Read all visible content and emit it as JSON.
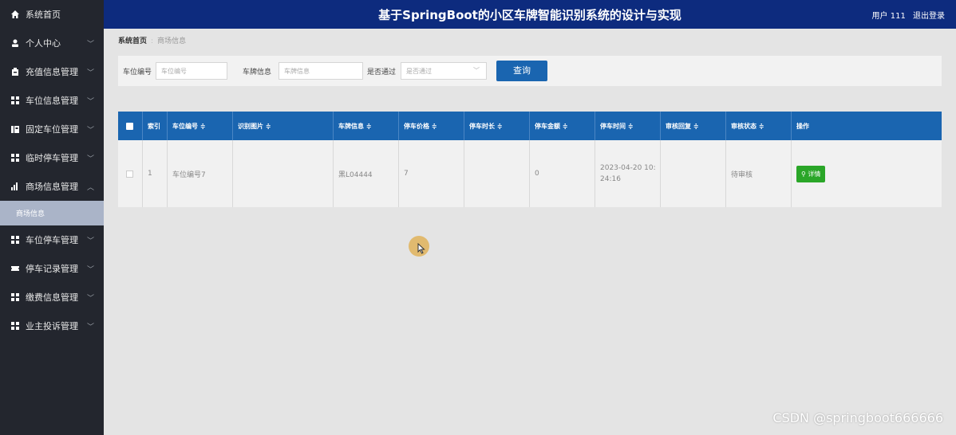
{
  "app": {
    "title": "基于SpringBoot的小区车牌智能识别系统的设计与实现",
    "user_label": "用户 111",
    "logout_label": "退出登录"
  },
  "sidebar": {
    "home": "系统首页",
    "items": [
      {
        "label": "个人中心",
        "icon": "user-icon"
      },
      {
        "label": "充值信息管理",
        "icon": "wallet-icon"
      },
      {
        "label": "车位信息管理",
        "icon": "grid-icon"
      },
      {
        "label": "固定车位管理",
        "icon": "parking-icon"
      },
      {
        "label": "临时停车管理",
        "icon": "grid-icon"
      },
      {
        "label": "商场信息管理",
        "icon": "bar-chart-icon"
      },
      {
        "label": "车位停车管理",
        "icon": "grid-icon"
      },
      {
        "label": "停车记录管理",
        "icon": "ticket-icon"
      },
      {
        "label": "缴费信息管理",
        "icon": "grid-icon"
      },
      {
        "label": "业主投诉管理",
        "icon": "grid-icon"
      }
    ],
    "active_sub": "商场信息"
  },
  "breadcrumb": {
    "root": "系统首页",
    "current": "商场信息"
  },
  "search": {
    "space_label": "车位编号",
    "space_placeholder": "车位编号",
    "plate_label": "车牌信息",
    "plate_placeholder": "车牌信息",
    "pass_label": "是否通过",
    "pass_placeholder": "是否通过",
    "query_button": "查询"
  },
  "table": {
    "headers": [
      "索引",
      "车位编号 ≑",
      "识别图片 ≑",
      "车牌信息 ≑",
      "停车价格 ≑",
      "停车时长 ≑",
      "停车金额 ≑",
      "停车时间 ≑",
      "审核回复 ≑",
      "审核状态 ≑",
      "操作"
    ],
    "rows": [
      {
        "index": "1",
        "space": "车位编号7",
        "image": "",
        "plate": "黑L04444",
        "price": "7",
        "duration": "",
        "amount": "0",
        "time": "2023-04-20 10:24:16",
        "reply": "",
        "status": "待审核",
        "action": "详情"
      }
    ]
  },
  "watermark": "CSDN @springboot666666",
  "colors": {
    "topbar": "#0d2b7e",
    "sidebar": "#23262e",
    "table_header": "#1a65b0",
    "detail_button": "#2aa628"
  }
}
